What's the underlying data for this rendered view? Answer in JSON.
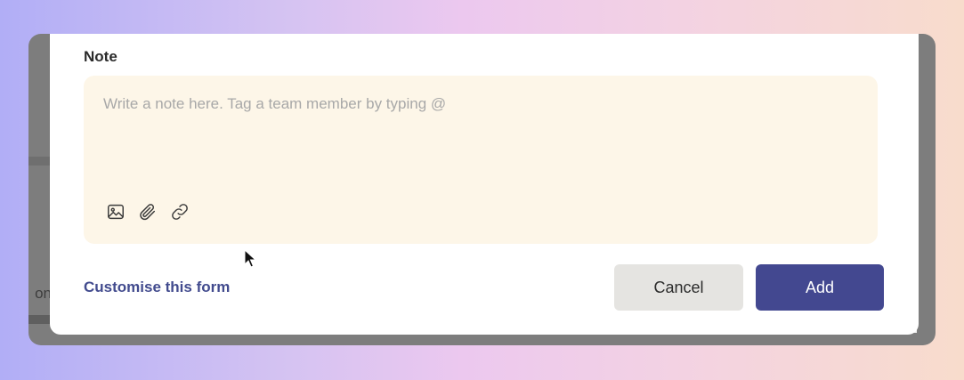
{
  "background_window": {
    "partial_text": "on"
  },
  "note": {
    "label": "Note",
    "placeholder": "Write a note here. Tag a team member by typing @",
    "value": "",
    "toolbar": [
      {
        "icon": "image-icon"
      },
      {
        "icon": "paperclip-icon"
      },
      {
        "icon": "link-icon"
      }
    ]
  },
  "footer": {
    "customise_link": "Customise this form",
    "cancel_label": "Cancel",
    "add_label": "Add"
  },
  "colors": {
    "note_box_bg": "#fdf6e8",
    "primary": "#434890",
    "link": "#424b8e",
    "cancel_bg": "#e5e4e1",
    "overlay": "#7d7d7d"
  }
}
